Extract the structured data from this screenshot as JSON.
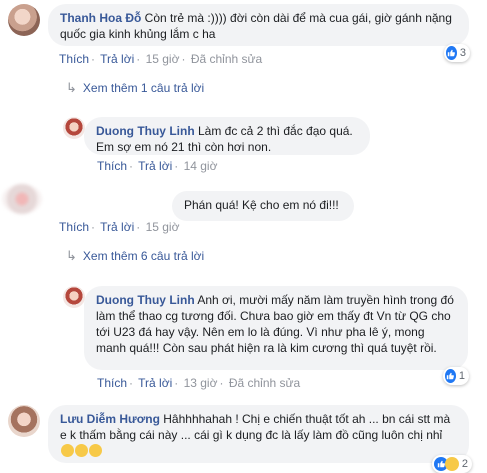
{
  "comments": [
    {
      "author": "Thanh Hoa Đỗ",
      "text": "Còn trẻ mà :)))) đời còn dài để mà cua gái, giờ gánh nặng quốc gia kinh khủng lắm c ha",
      "reaction_count": "3",
      "actions": {
        "like": "Thích",
        "reply": "Trả lời",
        "time": "15 giờ",
        "edited": "Đã chỉnh sửa"
      }
    },
    {
      "author": "Duong Thuy Linh",
      "text": "Làm đc cả 2 thì đắc đạo quá. Em sợ em nó 21 thì còn hơi non.",
      "actions": {
        "like": "Thích",
        "reply": "Trả lời",
        "time": "14 giờ"
      }
    },
    {
      "author": "",
      "text": "Phán quá! Kệ cho em nó đi!!!",
      "actions": {
        "like": "Thích",
        "reply": "Trả lời",
        "time": "15 giờ"
      }
    },
    {
      "author": "Duong Thuy Linh",
      "text": "Anh ơi, mười mấy năm làm truyền hình trong đó làm thể thao cg tương đối. Chưa bao giờ em thấy đt Vn từ QG cho tới U23 đá hay vậy. Nên em lo là đúng. Vì như pha lê ý, mong manh quá!!! Còn sau phát hiện ra là kim cương thì quá tuyệt rồi.",
      "reaction_count": "1",
      "actions": {
        "like": "Thích",
        "reply": "Trả lời",
        "time": "13 giờ",
        "edited": "Đã chỉnh sửa"
      }
    },
    {
      "author": "Lưu Diễm Hương",
      "text": "Hâhhhhahah ! Chị e chiến thuật tốt ah ... bn cái stt mà e k thấm bằng cái này ... cái gì k dụng đc là lấy làm đồ cũng luôn chị nhỉ",
      "reaction_count": "2"
    }
  ],
  "more_replies": [
    "Xem thêm 1 câu trả lời",
    "Xem thêm 6 câu trả lời"
  ],
  "colors": {
    "link": "#385898",
    "bubble": "#f2f3f5",
    "meta": "#90949c",
    "like": "#2078f4"
  }
}
